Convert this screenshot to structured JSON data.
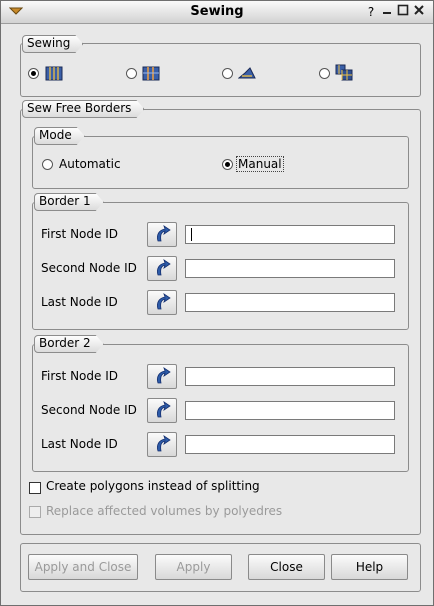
{
  "window": {
    "title": "Sewing",
    "help_glyph": "?",
    "minimize_glyph": "—",
    "maximize_glyph": "☐",
    "close_glyph": "✕"
  },
  "sewing_group": {
    "label": "Sewing",
    "options": [
      {
        "name": "free-borders-mode-icon",
        "selected": true
      },
      {
        "name": "conform-free-borders-icon",
        "selected": false
      },
      {
        "name": "border-to-side-icon",
        "selected": false
      },
      {
        "name": "side-elements-icon",
        "selected": false
      }
    ]
  },
  "sew_free_borders": {
    "label": "Sew Free Borders",
    "mode": {
      "label": "Mode",
      "automatic": "Automatic",
      "manual": "Manual",
      "selected": "Manual"
    },
    "border1": {
      "label": "Border 1",
      "first": "First Node ID",
      "second": "Second Node ID",
      "last": "Last Node ID",
      "first_value": "",
      "second_value": "",
      "last_value": ""
    },
    "border2": {
      "label": "Border 2",
      "first": "First Node ID",
      "second": "Second Node ID",
      "last": "Last Node ID",
      "first_value": "",
      "second_value": "",
      "last_value": ""
    }
  },
  "options": {
    "create_polygons": {
      "label": "Create polygons instead of splitting",
      "checked": false,
      "enabled": true
    },
    "replace_volumes": {
      "label": "Replace affected volumes by polyedres",
      "checked": false,
      "enabled": false
    }
  },
  "buttons": {
    "apply_close": "Apply and Close",
    "apply": "Apply",
    "close": "Close",
    "help": "Help"
  },
  "colors": {
    "accent_blue": "#2d5ba8",
    "window_bg": "#e8e8e8"
  }
}
